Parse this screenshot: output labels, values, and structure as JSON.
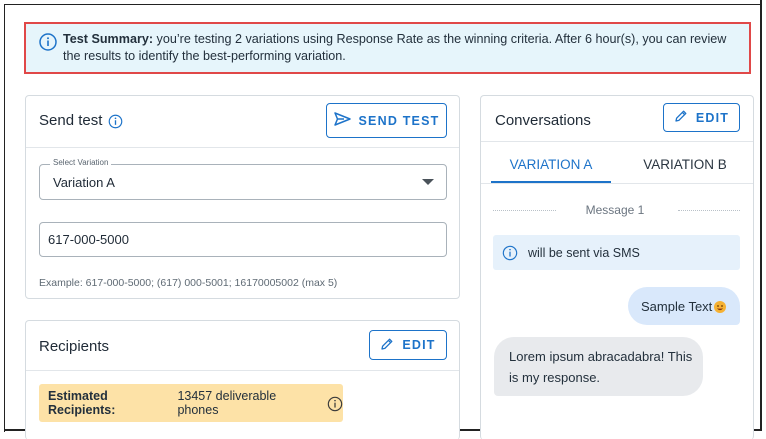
{
  "summary": {
    "label": "Test Summary:",
    "text": " you’re testing 2 variations using Response Rate as the winning criteria. After 6 hour(s), you can review the results to identify the best-performing variation."
  },
  "send_test": {
    "title": "Send test",
    "button_label": "SEND TEST",
    "select_legend": "Select Variation",
    "select_value": "Variation A",
    "phone_value": "617-000-5000",
    "hint": "Example: 617-000-5000; (617) 000-5001; 16170005002 (max 5)"
  },
  "recipients": {
    "title": "Recipients",
    "edit_label": "EDIT",
    "estimate_label": "Estimated Recipients:",
    "estimate_value": " 13457 deliverable phones"
  },
  "conversations": {
    "title": "Conversations",
    "edit_label": "EDIT",
    "tabs": [
      {
        "label": "VARIATION A",
        "active": true
      },
      {
        "label": "VARIATION B",
        "active": false
      }
    ],
    "message_label": "Message 1",
    "sms_note": "will be sent via SMS",
    "outgoing_text": "Sample Text",
    "incoming_text": "Lorem ipsum abracadabra! This is my response."
  },
  "colors": {
    "accent": "#1d73c9",
    "banner_bg": "#e6f5fb",
    "banner_border": "#e04848",
    "estimate_bg": "#fde2a7"
  },
  "icons": [
    "info-icon",
    "send-icon",
    "pencil-icon",
    "caret-down-icon",
    "emoji-icon"
  ]
}
